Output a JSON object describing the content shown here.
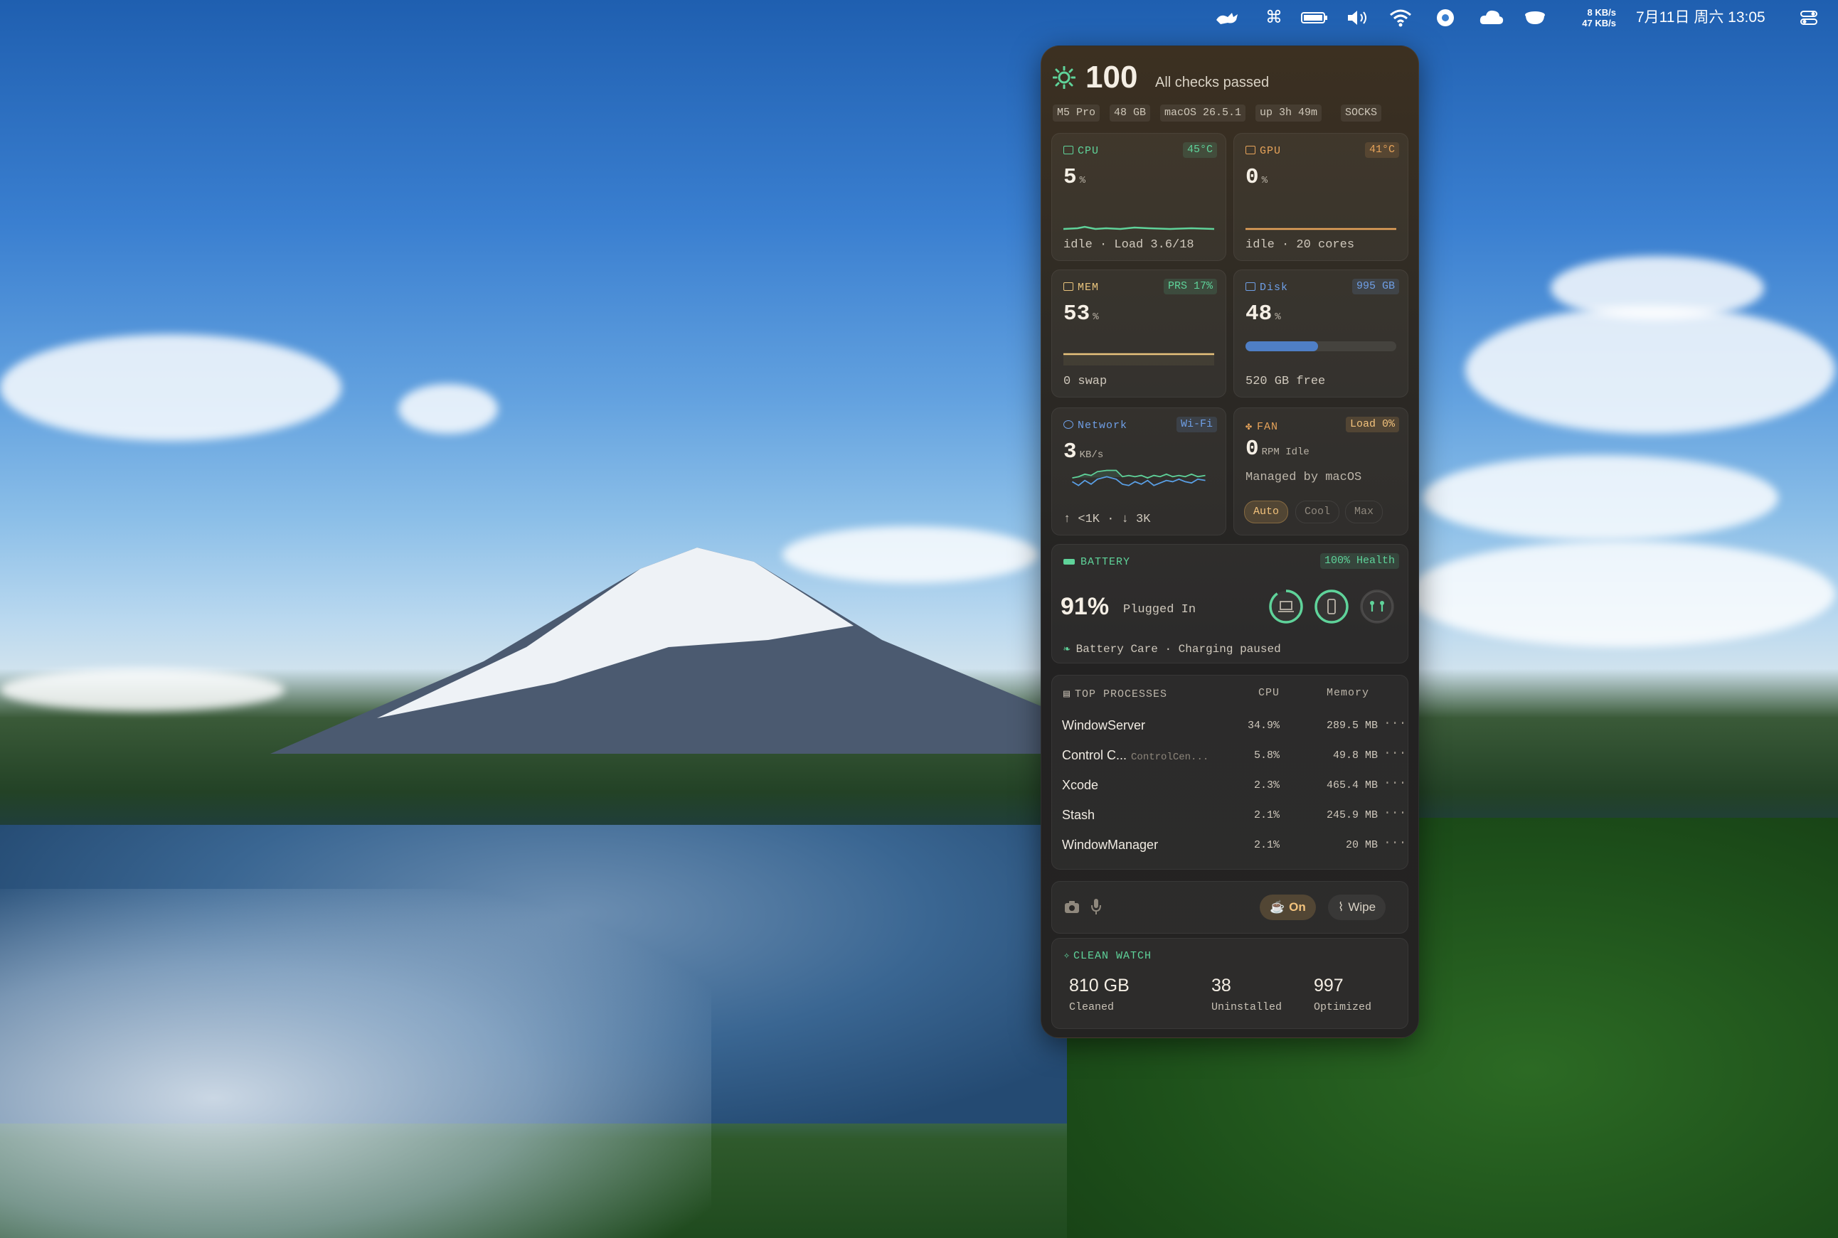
{
  "menubar": {
    "icons": [
      "cat-icon",
      "command-icon",
      "battery-icon",
      "volume-icon",
      "wifi-icon",
      "steering-icon",
      "cloud-icon",
      "cup-icon",
      "control-center-icon"
    ],
    "net_up": "8 KB/s",
    "net_down": "47 KB/s",
    "clock": "7月11日 周六 13:05"
  },
  "header": {
    "score": "100",
    "status": "All checks passed",
    "chips": [
      "M5 Pro",
      "48 GB",
      "macOS 26.5.1",
      "up 3h 49m",
      "SOCKS"
    ]
  },
  "cpu": {
    "title": "CPU",
    "badge": "45°C",
    "value": "5",
    "unit": "%",
    "foot": "idle · Load 3.6/18"
  },
  "gpu": {
    "title": "GPU",
    "badge": "41°C",
    "value": "0",
    "unit": "%",
    "foot": "idle · 20 cores"
  },
  "mem": {
    "title": "MEM",
    "badge": "PRS 17%",
    "value": "53",
    "unit": "%",
    "foot": "0 swap"
  },
  "disk": {
    "title": "Disk",
    "badge": "995 GB",
    "value": "48",
    "unit": "%",
    "fill": 0.48,
    "foot": "520 GB free"
  },
  "network": {
    "title": "Network",
    "badge": "Wi-Fi",
    "value": "3",
    "unit": "KB/s",
    "foot": "↑ <1K · ↓ 3K"
  },
  "fan": {
    "title": "FAN",
    "badge": "Load 0%",
    "value": "0",
    "unit": "RPM Idle",
    "managed": "Managed by macOS",
    "modes": [
      "Auto",
      "Cool",
      "Max"
    ],
    "active_mode": "Auto"
  },
  "battery": {
    "title": "BATTERY",
    "badge": "100% Health",
    "value": "91%",
    "status": "Plugged In",
    "care": "Battery Care · Charging paused",
    "rings": [
      "laptop-icon",
      "phone-icon",
      "airpods-icon"
    ]
  },
  "processes": {
    "title": "TOP PROCESSES",
    "col_cpu": "CPU",
    "col_mem": "Memory",
    "rows": [
      {
        "name": "WindowServer",
        "sub": "",
        "cpu": "34.9%",
        "mem": "289.5 MB"
      },
      {
        "name": "Control C...",
        "sub": "ControlCen...",
        "cpu": "5.8%",
        "mem": "49.8 MB"
      },
      {
        "name": "Xcode",
        "sub": "",
        "cpu": "2.3%",
        "mem": "465.4 MB"
      },
      {
        "name": "Stash",
        "sub": "",
        "cpu": "2.1%",
        "mem": "245.9 MB"
      },
      {
        "name": "WindowManager",
        "sub": "",
        "cpu": "2.1%",
        "mem": "20 MB"
      }
    ]
  },
  "privacy": {
    "on_label": "On",
    "wipe_label": "Wipe"
  },
  "clean": {
    "title": "CLEAN WATCH",
    "stats": [
      {
        "value": "810 GB",
        "label": "Cleaned"
      },
      {
        "value": "38",
        "label": "Uninstalled"
      },
      {
        "value": "997",
        "label": "Optimized"
      }
    ]
  },
  "colors": {
    "accent_green": "#5fd39a",
    "accent_orange": "#e6a35a",
    "accent_yellow": "#e8c37c",
    "accent_blue": "#6f9fe6"
  }
}
